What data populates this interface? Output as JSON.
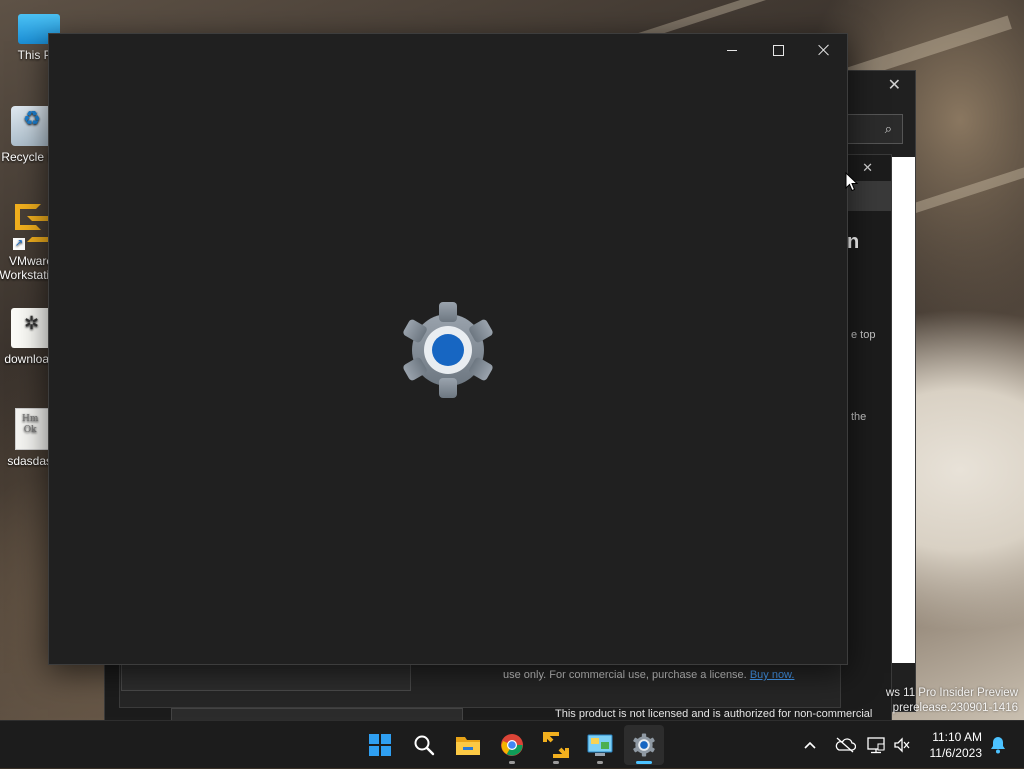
{
  "desktop": {
    "icons": [
      {
        "name": "this-pc",
        "label": "This PC",
        "icon": "monitor-icon"
      },
      {
        "name": "recycle-bin",
        "label": "Recycle Bin",
        "icon": "recycle-bin-icon"
      },
      {
        "name": "vmware-workstation",
        "label": "VMware Workstation",
        "icon": "vmware-icon"
      },
      {
        "name": "downloads",
        "label": "downloads",
        "icon": "downloads-icon"
      },
      {
        "name": "sdasdasd",
        "label": "sdasdasd",
        "icon": "document-icon"
      }
    ]
  },
  "background_window": {
    "large_title_fragment": "n",
    "text_fragment_1": "e top",
    "text_fragment_2": "the",
    "license_line_1": "use only. For commercial use, purchase a license.",
    "license_link": "Buy now.",
    "license_line_2": "This product is not licensed and is authorized for non-commercial"
  },
  "settings_window": {
    "app": "Settings",
    "state": "loading",
    "splash_icon": "settings-gear-icon",
    "caption_buttons": {
      "minimize": "minimize-icon",
      "maximize": "maximize-icon",
      "close": "close-icon"
    }
  },
  "watermark": {
    "line1": "ws 11 Pro Insider Preview",
    "line2": "prerelease.230901-1416"
  },
  "taskbar": {
    "apps": [
      {
        "name": "start",
        "icon": "windows-start-icon",
        "active": false
      },
      {
        "name": "search",
        "icon": "search-icon",
        "active": false
      },
      {
        "name": "file-explorer",
        "icon": "folder-icon",
        "active": false
      },
      {
        "name": "chrome",
        "icon": "chrome-icon",
        "active": false
      },
      {
        "name": "vmware",
        "icon": "vmware-icon",
        "active": false
      },
      {
        "name": "control-panel",
        "icon": "control-panel-icon",
        "active": false
      },
      {
        "name": "settings",
        "icon": "settings-gear-icon",
        "active": true
      }
    ],
    "tray_icons": [
      "chevron-up-icon",
      "onedrive-icon",
      "network-icon",
      "volume-muted-icon"
    ],
    "clock": {
      "time": "11:10 AM",
      "date": "11/6/2023"
    },
    "notifications_icon": "bell-icon"
  },
  "colors": {
    "accent": "#4cc2ff",
    "window_bg": "#202020",
    "taskbar_bg": "#1c1c1c",
    "link": "#4aa3ff"
  }
}
